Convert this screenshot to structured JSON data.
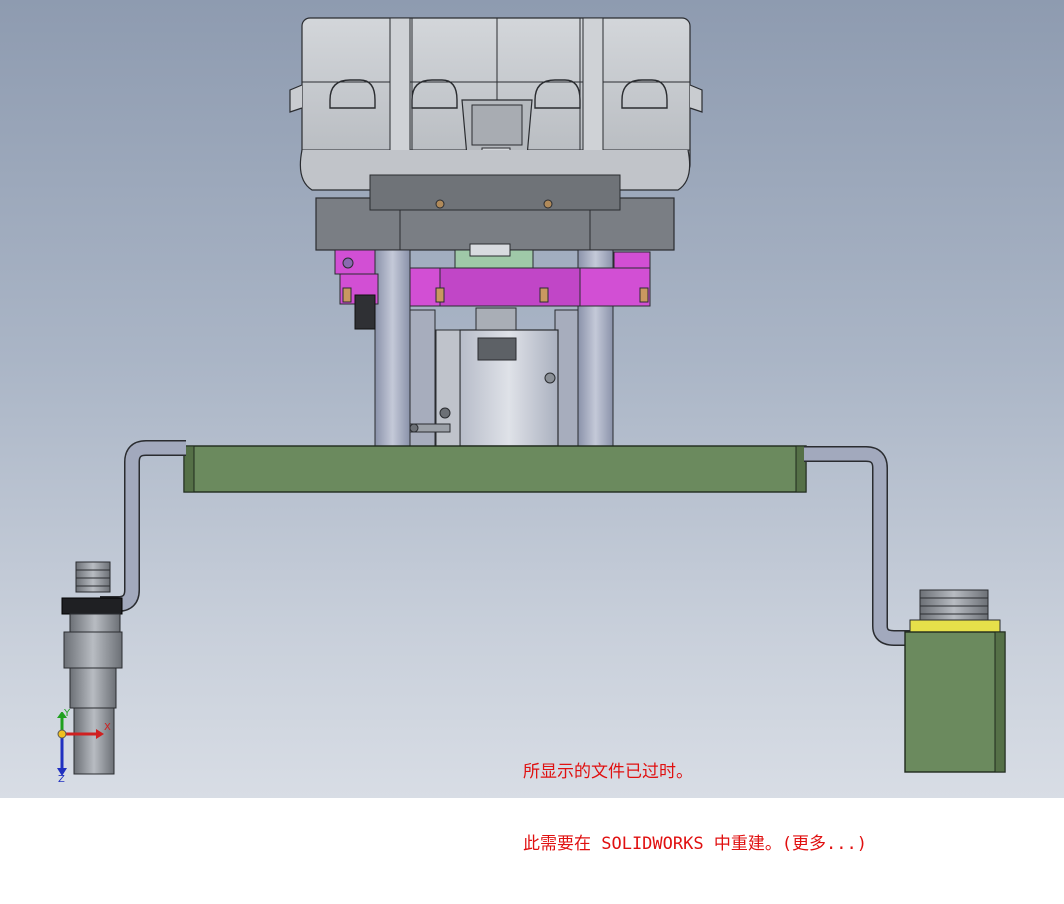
{
  "viewport": {
    "background": "#aab5c6",
    "warning_color": "#e01010"
  },
  "parts": {
    "housing_color": "#c4c7cc",
    "clamp_plate_color": "#d24fd4",
    "base_plate_color": "#6b8a5e",
    "dark_block_color": "#7a7e84",
    "rail_color": "#9ea6ba"
  },
  "triad": {
    "x_label": "X",
    "y_label": "Y",
    "z_label": "Z"
  },
  "warning": {
    "line1": "所显示的文件已过时。",
    "line2": "此需要在 SOLIDWORKS 中重建。(更多...)"
  }
}
